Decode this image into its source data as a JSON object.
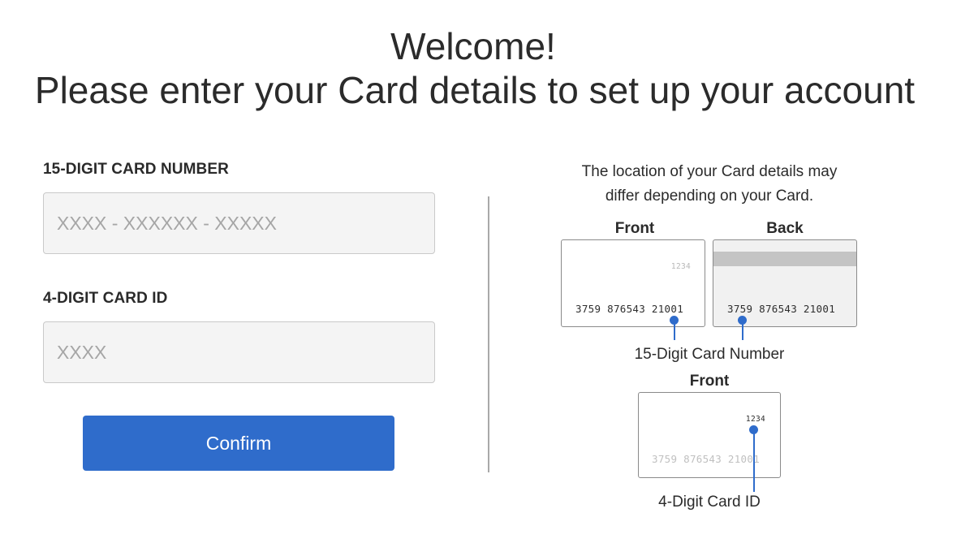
{
  "header": {
    "title_line1": "Welcome!",
    "title_line2": "Please enter your Card details to set up your account"
  },
  "form": {
    "card_number": {
      "label": "15-DIGIT CARD NUMBER",
      "value": "",
      "placeholder": "XXXX - XXXXXX - XXXXX"
    },
    "card_id": {
      "label": "4-DIGIT CARD ID",
      "value": "",
      "placeholder": "XXXX"
    },
    "confirm_label": "Confirm"
  },
  "help": {
    "text_line1": "The location of your Card details may",
    "text_line2": "differ depending on your Card.",
    "front_caption": "Front",
    "back_caption": "Back",
    "front2_caption": "Front",
    "sample_number": "3759 876543 21001",
    "sample_id": "1234",
    "number_callout": "15-Digit Card Number",
    "id_callout": "4-Digit Card ID"
  },
  "colors": {
    "accent": "#2f6ccb",
    "input_background": "#f4f4f4",
    "divider": "#a9a9a9"
  }
}
